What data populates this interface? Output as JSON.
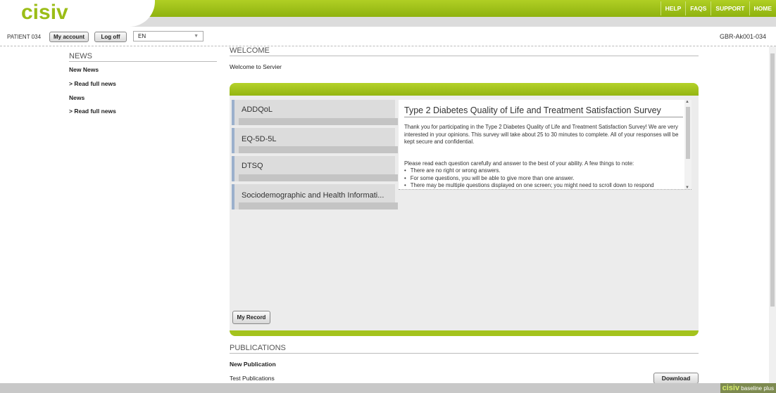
{
  "header": {
    "logo_text": "cisiv",
    "nav": [
      "HELP",
      "FAQS",
      "SUPPORT",
      "HOME"
    ]
  },
  "user": {
    "patient_label": "PATIENT 034",
    "my_account": "My account",
    "log_off": "Log off",
    "language": "EN",
    "site_code": "GBR-Ak001-034"
  },
  "news": {
    "heading": "NEWS",
    "items": [
      {
        "title": "New News",
        "link": "> Read full news"
      },
      {
        "title": "News",
        "link": "> Read full news"
      }
    ]
  },
  "welcome": {
    "heading": "WELCOME",
    "text": "Welcome to Servier"
  },
  "questionnaires": [
    {
      "label": "ADDQoL"
    },
    {
      "label": "EQ-5D-5L"
    },
    {
      "label": "DTSQ"
    },
    {
      "label": "Sociodemographic and Health Informati..."
    }
  ],
  "survey": {
    "title": "Type 2 Diabetes Quality of Life and Treatment Satisfaction Survey",
    "intro": "Thank you for participating in the Type 2 Diabetes Quality of Life and Treatment Satisfaction Survey! We are very interested in your opinions. This survey will take about 25 to 30 minutes to complete. All of your responses will be kept secure and confidential.",
    "instructions": "Please read each question carefully and answer to the best of your ability. A few things to note:",
    "bullets": [
      "There are no right or wrong answers.",
      "For some questions, you will be able to give more than one answer.",
      "There may be multiple questions displayed on one screen; you might need to scroll down to respond"
    ]
  },
  "my_record": "My Record",
  "publications": {
    "heading": "PUBLICATIONS",
    "title": "New Publication",
    "item": "Test Publications",
    "download": "Download"
  },
  "footer": {
    "brand": "cisiv",
    "tagline": "baseline plus"
  }
}
